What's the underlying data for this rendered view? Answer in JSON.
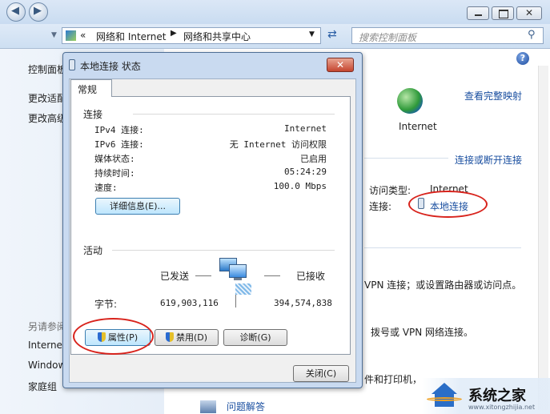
{
  "window": {
    "address_prefix": "«",
    "breadcrumb": [
      "网络和 Internet",
      "网络和共享中心"
    ],
    "search_placeholder": "搜索控制面板"
  },
  "left_panel": {
    "items": [
      "控制面板",
      "更改适配",
      "更改高级"
    ],
    "see_also_title": "另请参阅",
    "see_also_items": [
      "Internet",
      "Window",
      "家庭组"
    ]
  },
  "right_panel": {
    "view_full_map": "查看完整映射",
    "internet_label": "Internet",
    "connect_disconnect": "连接或断开连接",
    "access_type_label": "访问类型:",
    "access_type_value": "Internet",
    "connection_label": "连接:",
    "connection_value": "本地连接",
    "vpn_text_1": "VPN 连接；或设置路由器或访问点。",
    "vpn_text_2": "拨号或 VPN 网络连接。",
    "printer_text": "件和打印机，",
    "troubleshoot_text": "问题解答"
  },
  "dialog": {
    "title": "本地连接 状态",
    "close_glyph": "✕",
    "tab_label": "常规",
    "connection_section": "连接",
    "rows": [
      {
        "label": "IPv4 连接:",
        "value": "Internet"
      },
      {
        "label": "IPv6 连接:",
        "value": "无 Internet 访问权限"
      },
      {
        "label": "媒体状态:",
        "value": "已启用"
      },
      {
        "label": "持续时间:",
        "value": "05:24:29"
      },
      {
        "label": "速度:",
        "value": "100.0 Mbps"
      }
    ],
    "details_button": "详细信息(E)...",
    "activity_section": "活动",
    "sent_label": "已发送",
    "received_label": "已接收",
    "bytes_label": "字节:",
    "bytes_sent": "619,903,116",
    "bytes_received": "394,574,838",
    "properties_button": "属性(P)",
    "disable_button": "禁用(D)",
    "diagnose_button": "诊断(G)",
    "close_button": "关闭(C)"
  },
  "watermark": {
    "text": "系统之家",
    "url": "www.xitongzhijia.net"
  }
}
